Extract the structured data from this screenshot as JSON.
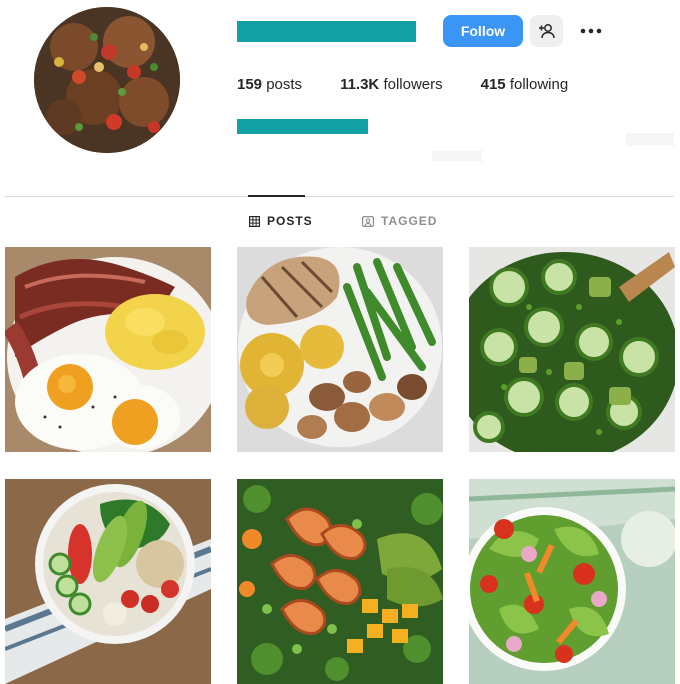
{
  "profile": {
    "avatar_icon": "food-dish-avatar",
    "stats": [
      {
        "value": "159",
        "label": "posts"
      },
      {
        "value": "11.3K",
        "label": "followers"
      },
      {
        "value": "415",
        "label": "following"
      }
    ]
  },
  "actions": {
    "follow_label": "Follow",
    "add_user_icon": "add-user-icon",
    "more_icon": "more-options-icon"
  },
  "tabs": [
    {
      "label": "POSTS",
      "icon": "grid-icon",
      "active": true
    },
    {
      "label": "TAGGED",
      "icon": "tag-icon",
      "active": false
    }
  ],
  "colors": {
    "follow_button": "#3b95f5",
    "redaction": "#12a0a5"
  },
  "posts": [
    {
      "subject": "bacon eggs scrambled"
    },
    {
      "subject": "grilled chicken green beans pineapple potatoes"
    },
    {
      "subject": "cucumber avocado salad"
    },
    {
      "subject": "avocado tomato quinoa bowl"
    },
    {
      "subject": "shrimp salad with mango"
    },
    {
      "subject": "green salad with tomatoes"
    }
  ]
}
